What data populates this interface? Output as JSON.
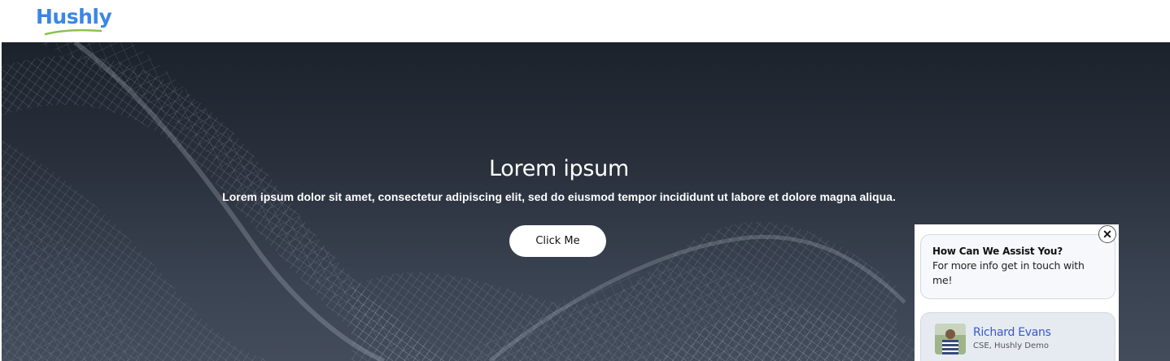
{
  "header": {
    "logo_text": "Hushly",
    "colors": {
      "logo": "#3b86e6",
      "swoosh": "#8bc34a"
    }
  },
  "hero": {
    "title": "Lorem ipsum",
    "subtitle": "Lorem ipsum dolor sit amet, consectetur adipiscing elit, sed do eiusmod tempor incididunt ut labore et dolore magna aliqua.",
    "button_label": "Click Me",
    "colors": {
      "background_top": "#1c222b",
      "background_bottom": "#434c5b",
      "mesh": "#aeb8c6"
    }
  },
  "widget": {
    "close_icon": "close-icon",
    "close_glyph": "✕",
    "assist_title": "How Can We Assist You?",
    "assist_text": "For more info get in touch with me!",
    "agent": {
      "name": "Richard Evans",
      "role": "CSE, Hushly Demo",
      "avatar_icon": "person-photo-icon"
    },
    "colors": {
      "agent_name": "#3a57c9"
    }
  }
}
